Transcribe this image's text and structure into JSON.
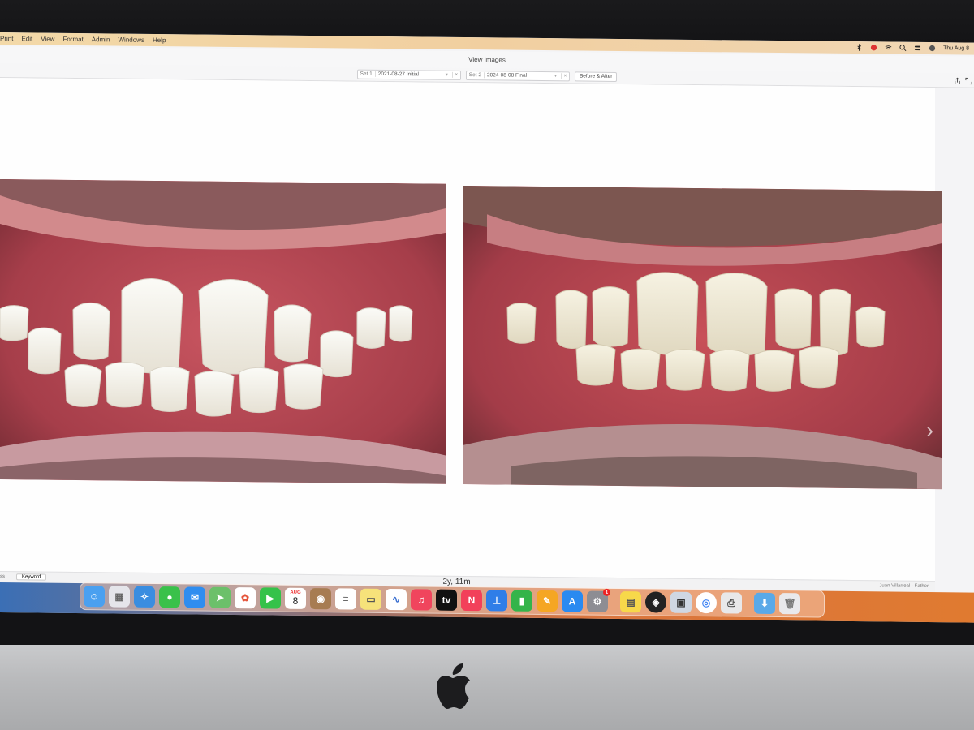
{
  "menubar": {
    "items": [
      "Print",
      "Edit",
      "View",
      "Format",
      "Admin",
      "Windows",
      "Help"
    ],
    "clock": "Thu Aug 8"
  },
  "window": {
    "title": "View Images"
  },
  "toolbar": {
    "set1_label": "Set 1",
    "set1_value": "2021-08-27 Initial",
    "set2_label": "Set 2",
    "set2_value": "2024-08-08 Final",
    "clear_glyph": "×",
    "before_after_label": "Before & After"
  },
  "photos": {
    "left_description": "before",
    "right_description": "after"
  },
  "statusbar": {
    "left_stub": "ss",
    "keyword_label": "Keyword",
    "elapsed": "2y, 11m",
    "user": "Juan Villarreal - Father"
  },
  "dock": {
    "calendar_month": "AUG",
    "calendar_day": "8",
    "app_store_badge": "1",
    "icons": [
      "finder-icon",
      "launchpad-icon",
      "safari-icon",
      "messages-icon",
      "mail-icon",
      "maps-icon",
      "photos-icon",
      "facetime-icon",
      "calendar-icon",
      "contacts-icon",
      "reminders-icon",
      "notes-icon",
      "freeform-icon",
      "music-icon",
      "tv-icon",
      "news-icon",
      "keynote-icon",
      "numbers-icon",
      "pages-icon",
      "app-store-icon",
      "system-settings-icon",
      "stickies-icon",
      "camo-icon",
      "preview-icon",
      "chrome-icon",
      "printer-icon",
      "downloads-icon",
      "trash-icon"
    ]
  },
  "colors": {
    "menubar_bg": "#f2d4a4",
    "dock_strip_blue": "#3b6fb5",
    "dock_strip_orange": "#e07a30",
    "gum": "#b84a52",
    "tooth": "#f3f1ea"
  }
}
